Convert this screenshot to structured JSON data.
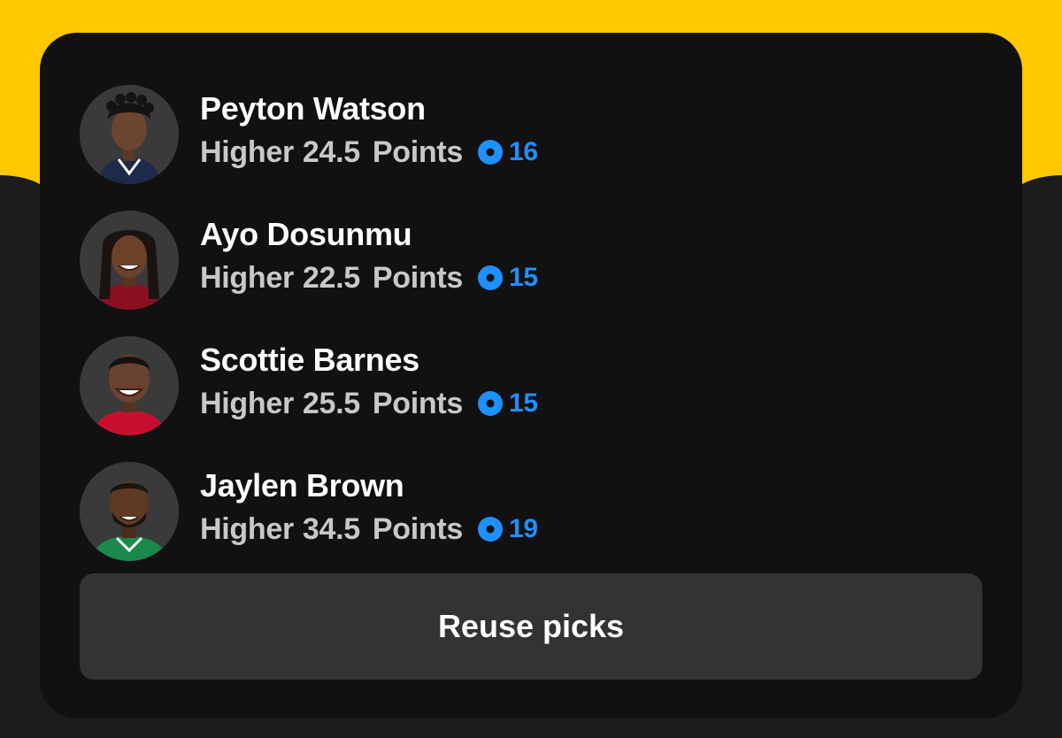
{
  "colors": {
    "accent_yellow": "#ffc800",
    "card_bg": "#111111",
    "coin_blue": "#1e90ff",
    "button_bg": "#333333"
  },
  "picks": [
    {
      "name": "Peyton Watson",
      "direction": "Higher",
      "line": "24.5",
      "stat": "Points",
      "coins": "16",
      "jersey": "#1d2a4a"
    },
    {
      "name": "Ayo Dosunmu",
      "direction": "Higher",
      "line": "22.5",
      "stat": "Points",
      "coins": "15",
      "jersey": "#8a1020"
    },
    {
      "name": "Scottie Barnes",
      "direction": "Higher",
      "line": "25.5",
      "stat": "Points",
      "coins": "15",
      "jersey": "#c8102e"
    },
    {
      "name": "Jaylen Brown",
      "direction": "Higher",
      "line": "34.5",
      "stat": "Points",
      "coins": "19",
      "jersey": "#1a8a4a"
    }
  ],
  "icons": {
    "coin": "coin-icon",
    "avatar": "player-headshot"
  },
  "actions": {
    "reuse_label": "Reuse picks"
  }
}
